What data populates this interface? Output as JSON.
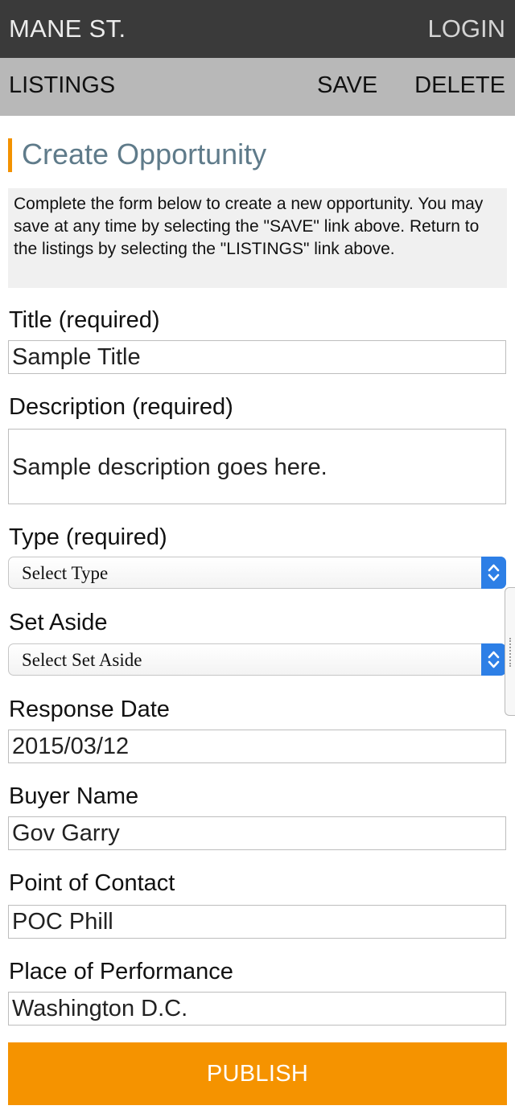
{
  "header": {
    "brand": "MANE ST.",
    "login_label": "LOGIN"
  },
  "nav": {
    "listings_label": "LISTINGS",
    "save_label": "SAVE",
    "delete_label": "DELETE"
  },
  "page": {
    "title": "Create Opportunity",
    "intro": "Complete the form below to create a new opportunity. You may save at any time by selecting the \"SAVE\" link above. Return to the listings by selecting the \"LISTINGS\" link above."
  },
  "form": {
    "title": {
      "label": "Title (required)",
      "value": "Sample Title"
    },
    "description": {
      "label": "Description (required)",
      "value": "Sample description goes here."
    },
    "type": {
      "label": "Type (required)",
      "selected": "Select Type"
    },
    "set_aside": {
      "label": "Set Aside",
      "selected": "Select Set Aside"
    },
    "response_date": {
      "label": "Response Date",
      "value": "2015/03/12"
    },
    "buyer_name": {
      "label": "Buyer Name",
      "value": "Gov Garry"
    },
    "point_of_contact": {
      "label": "Point of Contact",
      "value": "POC Phill"
    },
    "place_of_performance": {
      "label": "Place of Performance",
      "value": "Washington D.C."
    },
    "publish_label": "PUBLISH"
  },
  "icons": {
    "select_arrows": "chevron-up-down-icon",
    "scroll_handle": "drag-handle-icon"
  },
  "colors": {
    "topbar": "#3a3a3a",
    "subbar": "#b8b8b8",
    "accent": "#f59300",
    "title": "#5f7b8a",
    "select_button": "#2d7fe6"
  }
}
